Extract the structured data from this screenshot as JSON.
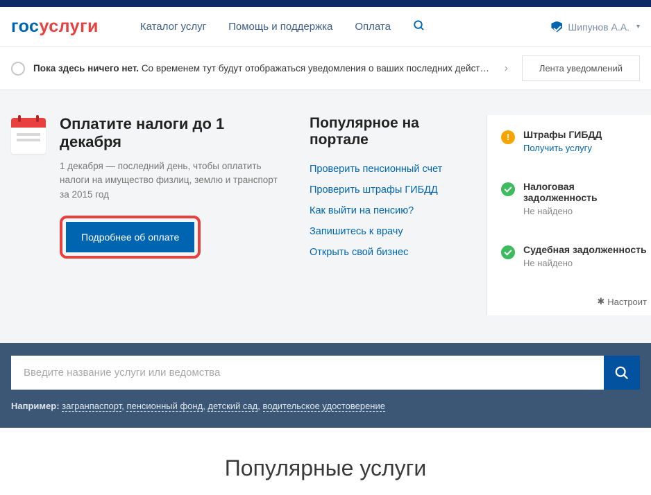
{
  "logo": {
    "part1": "гос",
    "part2": "услуги"
  },
  "nav": {
    "catalog": "Каталог услуг",
    "help": "Помощь и поддержка",
    "payment": "Оплата"
  },
  "user": {
    "name": "Шипунов А.А."
  },
  "notice": {
    "bold": "Пока здесь ничего нет.",
    "rest": "Со временем тут будут отображаться уведомления о ваших последних действиях на по...",
    "feed_btn": "Лента уведомлений"
  },
  "promo": {
    "title": "Оплатите налоги до 1 декабря",
    "desc": "1 декабря — последний день, чтобы оплатить налоги на имущество физлиц, землю и транспорт за 2015 год",
    "button": "Подробнее об оплате"
  },
  "popular": {
    "title": "Популярное на портале",
    "links": [
      "Проверить пенсионный счет",
      "Проверить штрафы ГИБДД",
      "Как выйти на пенсию?",
      "Запишитесь к врачу",
      "Открыть свой бизнес"
    ]
  },
  "side": {
    "items": [
      {
        "title": "Штрафы ГИБДД",
        "sub": "Получить услугу",
        "type": "warn",
        "subIsLink": true
      },
      {
        "title": "Налоговая задолженность",
        "sub": "Не найдено",
        "type": "ok",
        "subIsLink": false
      },
      {
        "title": "Судебная задолженность",
        "sub": "Не найдено",
        "type": "ok",
        "subIsLink": false
      }
    ],
    "configure": "Настроит"
  },
  "search": {
    "placeholder": "Введите название услуги или ведомства",
    "examples_label": "Например:",
    "examples": [
      "загранпаспорт",
      "пенсионный фонд",
      "детский сад",
      "водительское удостоверение"
    ]
  },
  "popular_services_heading": "Популярные услуги"
}
